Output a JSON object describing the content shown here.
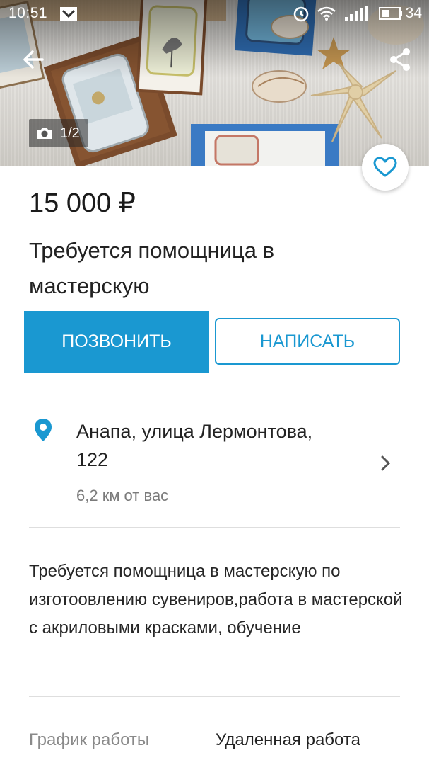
{
  "status_bar": {
    "time": "10:51",
    "battery": "34",
    "icons": [
      "notification-icon",
      "alarm-icon",
      "wifi-icon",
      "signal-icon",
      "battery-icon"
    ]
  },
  "gallery": {
    "counter": "1/2",
    "icons": {
      "back": "arrow-left-icon",
      "share": "share-icon",
      "camera": "camera-icon",
      "favorite": "heart-outline-icon"
    }
  },
  "listing": {
    "price": "15 000 ₽",
    "title": "Требуется помощница в мастерскую"
  },
  "actions": {
    "call_label": "ПОЗВОНИТЬ",
    "write_label": "НАПИСАТЬ"
  },
  "location": {
    "address": "Анапа, улица Лермонтова, 122",
    "distance": "6,2 км от вас",
    "icon": "location-pin-icon"
  },
  "description": "Требуется помощница в мастерскую по изготоовлению сувениров,работа в мастерской с акриловыми красками, обучение",
  "params": {
    "schedule_label": "График работы",
    "schedule_value": "Удаленная работа"
  },
  "colors": {
    "accent": "#1a98d1",
    "divider": "#dedede",
    "secondary_text": "#7a7a7a"
  }
}
